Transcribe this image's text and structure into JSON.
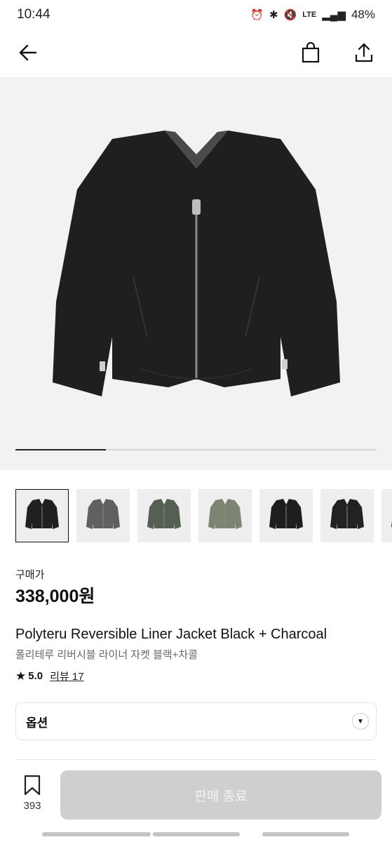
{
  "status_bar": {
    "time": "10:44",
    "network": "LTE",
    "battery": "48%"
  },
  "nav": {
    "back_icon": "back-arrow-icon",
    "bag_icon": "shopping-bag-icon",
    "share_icon": "share-icon"
  },
  "gallery": {
    "progress": 0.25,
    "image_count": 7
  },
  "thumbnails": [
    {
      "color": "#202020",
      "selected": true
    },
    {
      "color": "#5f615e",
      "selected": false
    },
    {
      "color": "#566052",
      "selected": false
    },
    {
      "color": "#7b8571",
      "selected": false
    },
    {
      "color": "#1e1e1e",
      "selected": false
    },
    {
      "color": "#222222",
      "selected": false
    },
    {
      "color": "#2a2a2a",
      "selected": false
    }
  ],
  "product": {
    "price_label": "구매가",
    "price": "338,000원",
    "title_en": "Polyteru Reversible Liner Jacket Black + Charcoal",
    "title_kr": "폴리테루 리버시블 라이너 자켓 블랙+차콜",
    "rating": "5.0",
    "review_label": "리뷰 17"
  },
  "option": {
    "label": "옵션"
  },
  "bottom": {
    "wish_count": "393",
    "sold_label": "판매 종료"
  },
  "colors": {
    "hero_bg": "#f2f2f2",
    "jacket": "#1f1f1f",
    "button_disabled": "#cfcfcf"
  }
}
